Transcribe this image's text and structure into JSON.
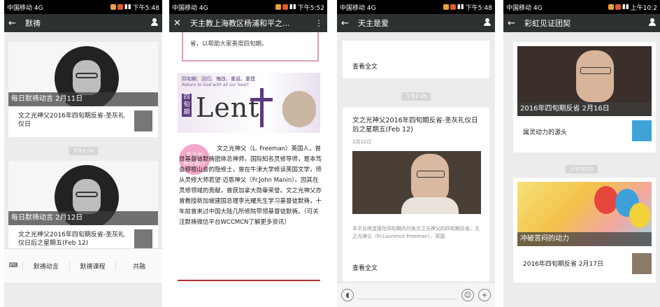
{
  "panels": [
    {
      "status": {
        "carrier": "中国移动 4G",
        "time": "下午5:48"
      },
      "topbar": {
        "title": "默祷"
      },
      "cards": [
        {
          "caption": "每日默祷动言 2月11日",
          "item": "文之光神父2016年四旬期反省-圣灰礼仪日"
        },
        {
          "caption": "每日默祷动言 2月12日",
          "item": "文之光神父2016年四旬期反省-圣灰礼仪日后之星期五(Feb 12)"
        }
      ],
      "timestamp": "下午2:54",
      "menu": [
        "默祷动言",
        "默祷课程",
        "共融"
      ]
    },
    {
      "status": {
        "carrier": "中国移动 4G",
        "time": "下午5:52"
      },
      "topbar": {
        "title": "天主教上海教区杨浦和平之..."
      },
      "top_text": "省，以帮助大家善度四旬期。",
      "lent_banner": {
        "top_line": "四旬期：回归、悔改、重返、重建",
        "sub_line": "Return to God with all our heart",
        "side_label": "四旬期",
        "big_word": "Lent"
      },
      "intro_badge": "文之光\n神父简介",
      "intro_text": "文之光神父（L. Freeman）英国人，曾世基督徒默祷团体总神师，国际知名灵修导师，是本笃会穆根山会的隐修士，曾在牛津大学修读英国文学，师从灵修大师若望·迈恩神父（Fr.John Manin）。因其在灵修领域的贡献，曾获加拿大勋章荣誉。文之光神父亦曾教授新加坡建国总理李光耀先生学习基督徒默祷，十年前曾来过中国大陆几所修院带领基督徒默祷。（可关注默祷微信平台WCCMCN了解更多资讯）"
    },
    {
      "status": {
        "carrier": "中国移动 4G",
        "time": "下午5:48"
      },
      "topbar": {
        "title": "天主是爱"
      },
      "top_read_more": "查看全文",
      "timestamp": "下午1:35",
      "article": {
        "title": "文之光神父2016年四旬期反省-圣灰礼仪日后之星期五(Feb 12)",
        "date": "2月12日",
        "summary": "本平台将连接在四旬期内刊发文之光神父的四旬期反省。文之光神父（Fr.Laurence Freeman），英国",
        "read_more": "查看全文"
      }
    },
    {
      "status": {
        "carrier": "中国移动 4G",
        "time": "上午10:2"
      },
      "topbar": {
        "title": "彩虹见证团契"
      },
      "cards": [
        {
          "caption": "2016年四旬期反省 2月16日",
          "item": "属灵动力的源头"
        },
        {
          "caption": "冲破苦闷的动力",
          "item": "2016年四旬期反省 2月17日"
        }
      ],
      "timestamp": "上午10:25"
    }
  ],
  "colors": {
    "topbar": "#2e3132",
    "caption_overlay": "#3c3c3c",
    "pink": "#f3a7c9",
    "lent_purple": "#5a3b7a"
  }
}
